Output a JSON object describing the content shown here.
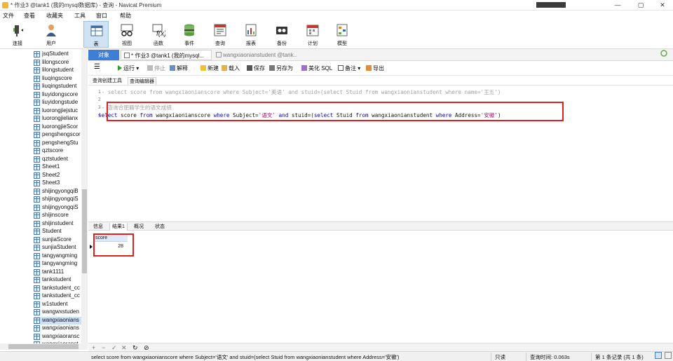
{
  "window": {
    "title": "* 作业3 @tank1 (我的mysql数据库) - 查询 - Navicat Premium",
    "controls": [
      "—",
      "▢",
      "✕"
    ]
  },
  "menu": [
    "文件",
    "查看",
    "收藏夹",
    "工具",
    "窗口",
    "帮助"
  ],
  "toolbar": {
    "buttons": [
      {
        "label": "连接",
        "icon": "connection-icon"
      },
      {
        "label": "用户",
        "icon": "user-icon"
      },
      {
        "label": "表",
        "icon": "table-icon"
      },
      {
        "label": "视图",
        "icon": "view-icon"
      },
      {
        "label": "函数",
        "icon": "function-icon"
      },
      {
        "label": "事件",
        "icon": "event-icon"
      },
      {
        "label": "查询",
        "icon": "query-icon"
      },
      {
        "label": "报表",
        "icon": "report-icon"
      },
      {
        "label": "备份",
        "icon": "backup-icon"
      },
      {
        "label": "计划",
        "icon": "schedule-icon"
      },
      {
        "label": "模型",
        "icon": "model-icon"
      }
    ]
  },
  "sidebar": {
    "items": [
      "jsqStudent",
      "lilongscore",
      "lilongstudent",
      "liuqingscore",
      "liuqingstudent",
      "liuyidongscore",
      "liuyidongstude",
      "luorongjiejstuc",
      "luorongjielianx",
      "luorongjieScor",
      "pengshengscor",
      "pengshengStu",
      "qztscore",
      "qztstudent",
      "Sheet1",
      "Sheet2",
      "Sheet3",
      "shijingyongqiB",
      "shijingyongqiS",
      "shijingyongqiS",
      "shijinscore",
      "shijinstudent",
      "Student",
      "sunjiaScore",
      "sunjiaStudent",
      "tangyangming",
      "tangyangming",
      "tank1111",
      "tankstudent",
      "tankstudent_cc",
      "tankstudent_cc",
      "w1student",
      "wangwxstuden",
      "wangxiaonians",
      "wangxiaonians",
      "wangxiaoransc",
      "wangxiaoranst"
    ],
    "selected_index": 33
  },
  "tabs": {
    "object": "对象",
    "query_tab": "* 作业3 @tank1 (我的mysql...",
    "other_tab": "wangxiaonianstudent @tank..."
  },
  "query_toolbar": {
    "run": "运行",
    "stop": "停止",
    "explain": "解释",
    "new": "新建",
    "load": "载入",
    "save": "保存",
    "save_as": "另存为",
    "beautify": "美化 SQL",
    "comment": "备注",
    "export": "导出"
  },
  "subtabs": [
    "查询创建工具",
    "查询编辑器"
  ],
  "editor": {
    "line_numbers": [
      "1",
      "2",
      "3",
      "4"
    ],
    "line1": "-- select score from wangxiaonianscore where Subject='英语' and stuid=(select Stuid from wangxiaonianstudent where name='王五')",
    "line3": "-- 查询合肥籍学生的语文成绩",
    "line4_parts": [
      {
        "t": "select",
        "c": "kw"
      },
      {
        "t": " score ",
        "c": "plain"
      },
      {
        "t": "from",
        "c": "kw"
      },
      {
        "t": " wangxiaonianscore ",
        "c": "plain"
      },
      {
        "t": "where",
        "c": "kw"
      },
      {
        "t": " Subject=",
        "c": "plain"
      },
      {
        "t": "'语文'",
        "c": "str"
      },
      {
        "t": " ",
        "c": "plain"
      },
      {
        "t": "and",
        "c": "kw"
      },
      {
        "t": " stuid=(",
        "c": "plain"
      },
      {
        "t": "select",
        "c": "kw"
      },
      {
        "t": " Stuid ",
        "c": "plain"
      },
      {
        "t": "from",
        "c": "kw"
      },
      {
        "t": " wangxiaonianstudent ",
        "c": "plain"
      },
      {
        "t": "where",
        "c": "kw"
      },
      {
        "t": " Address=",
        "c": "plain"
      },
      {
        "t": "'安徽'",
        "c": "str"
      },
      {
        "t": ")",
        "c": "plain"
      }
    ]
  },
  "result_tabs": [
    "信息",
    "结果1",
    "概况",
    "状态"
  ],
  "result": {
    "column": "score",
    "value": "28"
  },
  "grid_toolbar": [
    "+",
    "−",
    "✓",
    "✕",
    "↻",
    "⊘"
  ],
  "status": {
    "sql": "select score from wangxiaonianscore where Subject='语文' and stuid=(select Stuid from wangxiaonianstudent where Address='安徽')",
    "mode": "只读",
    "time": "查询时间: 0.063s",
    "records": "第 1 条记录 (共 1 条)"
  }
}
